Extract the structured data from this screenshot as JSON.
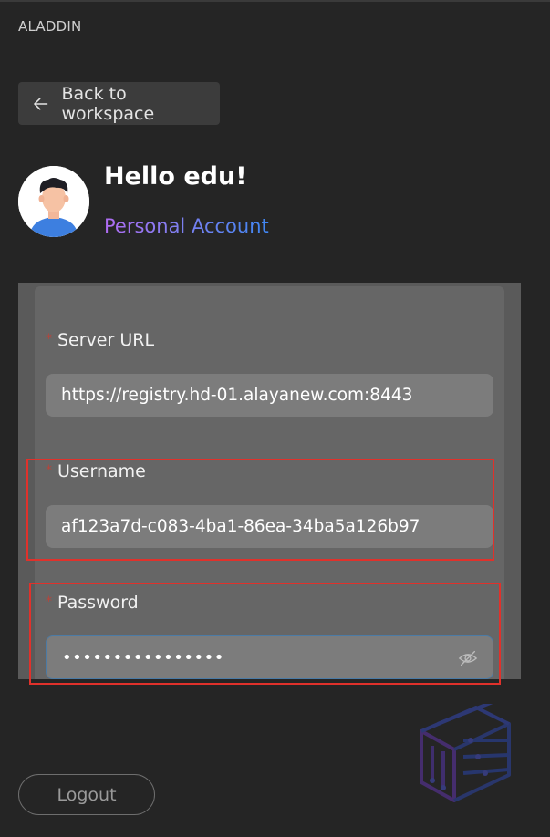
{
  "app": {
    "brand": "ALADDIN"
  },
  "nav": {
    "back_label": "Back to workspace"
  },
  "profile": {
    "greeting": "Hello edu!",
    "account_type": "Personal Account"
  },
  "form": {
    "server_url": {
      "label": "Server URL",
      "value": "https://registry.hd-01.alayanew.com:8443"
    },
    "username": {
      "label": "Username",
      "value": "af123a7d-c083-4ba1-86ea-34ba5a126b97"
    },
    "password": {
      "label": "Password",
      "value": "••••••••••••••••"
    },
    "required_marker": "*"
  },
  "footer": {
    "logout_label": "Logout"
  },
  "icons": {
    "back": "arrow-left-icon",
    "password_visibility": "eye-off-icon",
    "watermark": "cube-logo-icon"
  },
  "colors": {
    "accent_gradient_start": "#b06cf2",
    "accent_gradient_end": "#3f86f2",
    "highlight": "#e0312b",
    "required": "#b8453c"
  }
}
